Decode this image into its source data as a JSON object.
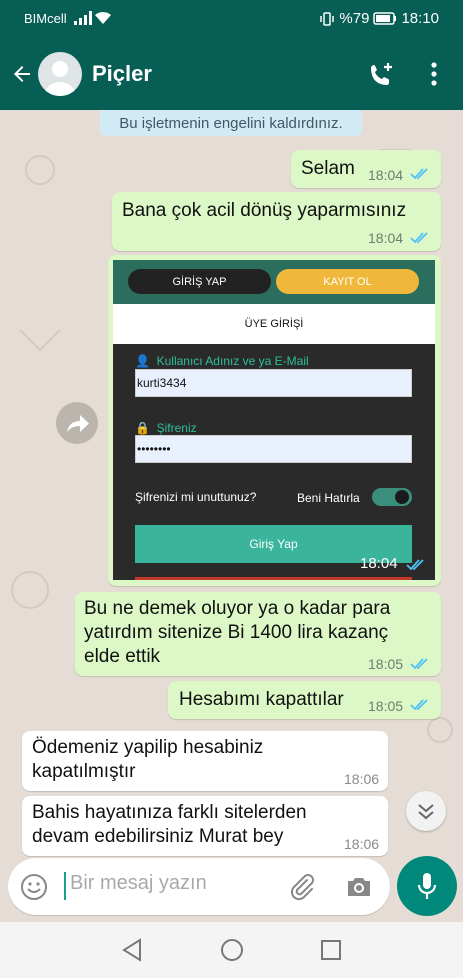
{
  "status_bar": {
    "carrier": "BIMcell",
    "battery": "%79",
    "time": "18:10"
  },
  "header": {
    "contact_name": "Piçler",
    "icons": [
      "back-arrow-icon",
      "avatar",
      "add-call-icon",
      "more-vert-icon"
    ]
  },
  "system_notice": "Bu işletmenin engelini kaldırdınız.",
  "messages": [
    {
      "dir": "out",
      "text": "Selam",
      "time": "18:04"
    },
    {
      "dir": "out",
      "text": "Bana çok acil dönüş yaparmısınız",
      "time": "18:04"
    },
    {
      "dir": "out",
      "type": "image",
      "time": "18:04",
      "image": {
        "tab_login": "GİRİŞ YAP",
        "tab_register": "KAYIT OL",
        "section_title": "ÜYE GİRİŞİ",
        "username_label": "Kullanıcı Adınız ve ya E-Mail",
        "username_value": "kurti3434",
        "password_label": "Şifreniz",
        "password_value": "••••••••",
        "forgot": "Şifrenizi mi unuttunuz?",
        "remember": "Beni Hatırla",
        "login_button": "Giriş Yap"
      }
    },
    {
      "dir": "out",
      "text": "Bu ne demek oluyor ya o kadar para yatırdım sitenize Bi 1400 lira kazanç elde ettik",
      "time": "18:05"
    },
    {
      "dir": "out",
      "text": "Hesabımı kapattılar",
      "time": "18:05"
    },
    {
      "dir": "in",
      "text": "Ödemeniz yapilip hesabiniz kapatılmıştır",
      "time": "18:06"
    },
    {
      "dir": "in",
      "text": "Bahis hayatınıza farklı sitelerden devam edebilirsiniz Murat bey",
      "time": "18:06"
    }
  ],
  "composer": {
    "placeholder": "Bir mesaj yazın"
  },
  "colors": {
    "header": "#075e54",
    "outgoing": "#dcf8c6",
    "incoming": "#ffffff",
    "accent": "#00897b",
    "read_ticks": "#4fc3f7"
  }
}
